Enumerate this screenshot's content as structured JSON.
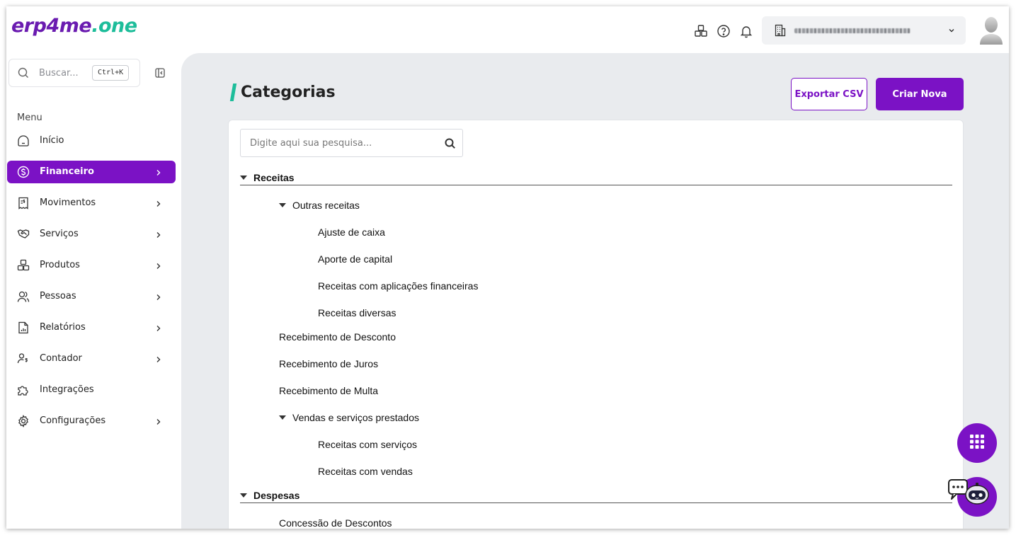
{
  "brand": {
    "logo_part1": "erp4me",
    "logo_part2": ".one"
  },
  "header": {
    "icons": [
      "cubes-icon",
      "help-icon",
      "bell-icon"
    ],
    "company_select": {
      "icon": "building-icon"
    }
  },
  "sidebar": {
    "search": {
      "placeholder": "Buscar...",
      "shortcut": "Ctrl+K"
    },
    "menu_title": "Menu",
    "items": [
      {
        "label": "Início",
        "icon": "home-icon",
        "has_submenu": false,
        "active": false
      },
      {
        "label": "Financeiro",
        "icon": "dollar-circle-icon",
        "has_submenu": true,
        "active": true
      },
      {
        "label": "Movimentos",
        "icon": "receipt-icon",
        "has_submenu": true,
        "active": false
      },
      {
        "label": "Serviços",
        "icon": "handshake-icon",
        "has_submenu": true,
        "active": false
      },
      {
        "label": "Produtos",
        "icon": "cubes-icon",
        "has_submenu": true,
        "active": false
      },
      {
        "label": "Pessoas",
        "icon": "people-icon",
        "has_submenu": true,
        "active": false
      },
      {
        "label": "Relatórios",
        "icon": "report-icon",
        "has_submenu": true,
        "active": false
      },
      {
        "label": "Contador",
        "icon": "accountant-icon",
        "has_submenu": true,
        "active": false
      },
      {
        "label": "Integrações",
        "icon": "puzzle-icon",
        "has_submenu": false,
        "active": false
      },
      {
        "label": "Configurações",
        "icon": "gear-icon",
        "has_submenu": true,
        "active": false
      }
    ]
  },
  "main": {
    "title": "Categorias",
    "export_label": "Exportar CSV",
    "create_label": "Criar Nova",
    "search_placeholder": "Digite aqui sua pesquisa...",
    "tree": [
      {
        "label": "Receitas",
        "level": 0,
        "expandable": true
      },
      {
        "label": "Outras receitas",
        "level": 1,
        "expandable": true
      },
      {
        "label": "Ajuste de caixa",
        "level": 2,
        "expandable": false
      },
      {
        "label": "Aporte de capital",
        "level": 2,
        "expandable": false
      },
      {
        "label": "Receitas com aplicações financeiras",
        "level": 2,
        "expandable": false
      },
      {
        "label": "Receitas diversas",
        "level": 2,
        "expandable": false
      },
      {
        "label": "Recebimento de Desconto",
        "level": 1,
        "expandable": false
      },
      {
        "label": "Recebimento de Juros",
        "level": 1,
        "expandable": false
      },
      {
        "label": "Recebimento de Multa",
        "level": 1,
        "expandable": false
      },
      {
        "label": "Vendas e serviços prestados",
        "level": 1,
        "expandable": true
      },
      {
        "label": "Receitas com serviços",
        "level": 2,
        "expandable": false
      },
      {
        "label": "Receitas com vendas",
        "level": 2,
        "expandable": false
      },
      {
        "label": "Despesas",
        "level": 0,
        "expandable": true
      },
      {
        "label": "Concessão de Descontos",
        "level": 1,
        "expandable": false
      }
    ]
  },
  "floating": {
    "apps_icon": "apps-grid-icon",
    "chat_icon": "chatbot-icon"
  },
  "colors": {
    "brand_purple": "#7b12c5",
    "brand_green": "#1dbd9a",
    "main_bg": "#e9ebee"
  }
}
